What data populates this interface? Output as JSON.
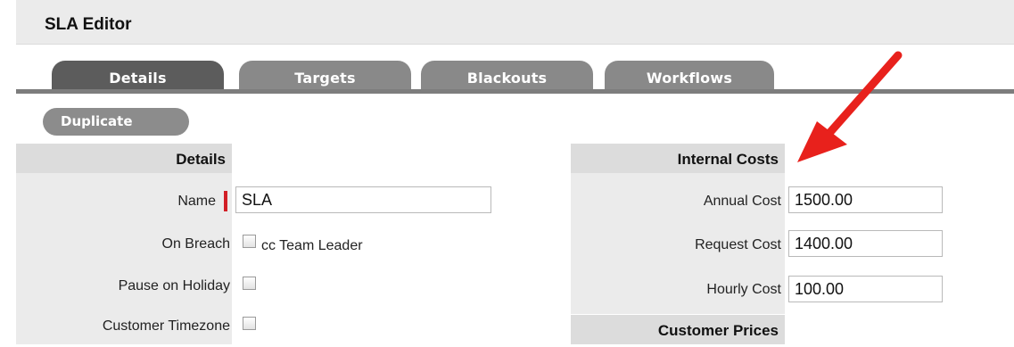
{
  "window": {
    "title": "SLA Editor"
  },
  "tabs": [
    {
      "label": "Details",
      "active": true
    },
    {
      "label": "Targets",
      "active": false
    },
    {
      "label": "Blackouts",
      "active": false
    },
    {
      "label": "Workflows",
      "active": false
    }
  ],
  "toolbar": {
    "duplicate_label": "Duplicate"
  },
  "details": {
    "heading": "Details",
    "name_label": "Name",
    "name_value": "SLA",
    "on_breach_label": "On Breach",
    "cc_team_leader_label": "cc Team Leader",
    "pause_on_holiday_label": "Pause on Holiday",
    "customer_timezone_label": "Customer Timezone"
  },
  "internal_costs": {
    "heading": "Internal Costs",
    "annual_cost_label": "Annual Cost",
    "annual_cost_value": "1500.00",
    "request_cost_label": "Request Cost",
    "request_cost_value": "1400.00",
    "hourly_cost_label": "Hourly Cost",
    "hourly_cost_value": "100.00"
  },
  "customer_prices": {
    "heading": "Customer Prices"
  },
  "annotation": {
    "arrow_color": "#e8211c"
  }
}
